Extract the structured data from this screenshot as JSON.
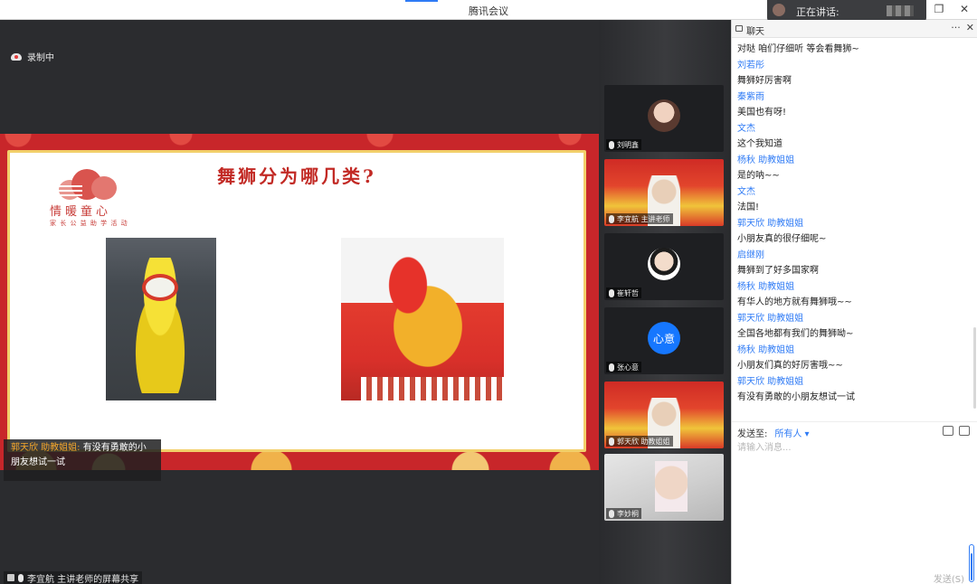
{
  "window": {
    "title": "腾讯会议",
    "speaking_label": "正在讲话:",
    "controls": [
      "⎯",
      "❐",
      "✕"
    ]
  },
  "recording": {
    "label": "录制中"
  },
  "slide": {
    "title": "舞狮分为哪几类?",
    "logo_name": "情暖童心",
    "logo_slogan": "家 长 公 益 助 学 活 动"
  },
  "caption": {
    "sender": "郭天欣 助教姐姐:",
    "text": "有没有勇敢的小朋友想试一试"
  },
  "screen_share": {
    "label": "李宜航 主讲老师的屏幕共享"
  },
  "participants": [
    {
      "name": "刘明鑫"
    },
    {
      "name": "李宜航 主讲老师"
    },
    {
      "name": "崔轩哲"
    },
    {
      "name": "张心意",
      "avatar_text": "心意"
    },
    {
      "name": "郭天欣 助教姐姐"
    },
    {
      "name": "李妙桐"
    }
  ],
  "chat": {
    "title": "聊天",
    "header_actions": [
      "···",
      "✕"
    ],
    "messages": [
      {
        "type": "text",
        "text": "对哒  咱们仔细听  等会看舞狮~"
      },
      {
        "type": "sender",
        "text": "刘若彤"
      },
      {
        "type": "text",
        "text": "舞狮好厉害啊"
      },
      {
        "type": "sender",
        "text": "秦紫雨"
      },
      {
        "type": "text",
        "text": "美国也有呀!"
      },
      {
        "type": "sender",
        "text": "文杰"
      },
      {
        "type": "text",
        "text": "这个我知道"
      },
      {
        "type": "sender",
        "text": "杨秋  助教姐姐"
      },
      {
        "type": "text",
        "text": "是的呐~~"
      },
      {
        "type": "sender",
        "text": "文杰"
      },
      {
        "type": "text",
        "text": "法国!"
      },
      {
        "type": "sender",
        "text": " 郭天欣  助教姐姐"
      },
      {
        "type": "text",
        "text": "小朋友真的很仔细呢~"
      },
      {
        "type": "sender",
        "text": "启继刚"
      },
      {
        "type": "text",
        "text": "舞狮到了好多国家啊"
      },
      {
        "type": "sender",
        "text": "杨秋  助教姐姐"
      },
      {
        "type": "text",
        "text": "有华人的地方就有舞狮哦~~"
      },
      {
        "type": "sender",
        "text": " 郭天欣  助教姐姐"
      },
      {
        "type": "text",
        "text": "全国各地都有我们的舞狮呦~"
      },
      {
        "type": "sender",
        "text": "杨秋  助教姐姐"
      },
      {
        "type": "text",
        "text": "小朋友们真的好厉害哦~~"
      },
      {
        "type": "sender",
        "text": " 郭天欣  助教姐姐"
      },
      {
        "type": "text",
        "text": "有没有勇敢的小朋友想试一试"
      }
    ],
    "send_to_label": "发送至:",
    "send_to_target": "所有人 ▾",
    "input_placeholder": "请输入消息...",
    "send_label": "发送(S)"
  },
  "colors": {
    "accent": "#2f7bf5",
    "slide_red": "#c8262a",
    "title_red": "#c22a25",
    "caption_orange": "#f4a62a"
  }
}
